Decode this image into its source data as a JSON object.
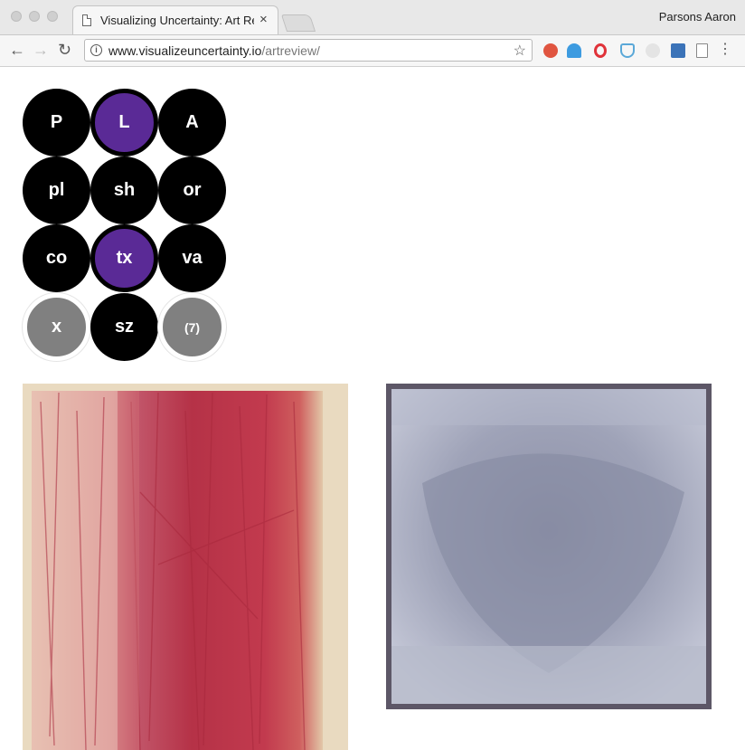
{
  "browser": {
    "tab_title": "Visualizing Uncertainty: Art Re",
    "tab_close": "×",
    "profile_name": "Parsons Aaron",
    "back_glyph": "←",
    "forward_glyph": "→",
    "reload_glyph": "↻",
    "url_host": "www.visualizeuncertainty.io",
    "url_path": "/artreview/",
    "info_glyph": "i",
    "star_glyph": "☆",
    "menu_glyph": "⋮",
    "extensions": [
      "adblock-icon",
      "news-globe-icon",
      "opera-icon",
      "shield-icon",
      "pin-icon",
      "new-badge-icon",
      "page-icon"
    ]
  },
  "grid": {
    "selected_color": "#5a2a96",
    "default_color": "#000000",
    "disabled_color": "#808080",
    "buttons": [
      {
        "label": "P",
        "state": "default"
      },
      {
        "label": "L",
        "state": "selected"
      },
      {
        "label": "A",
        "state": "default"
      },
      {
        "label": "pl",
        "state": "default"
      },
      {
        "label": "sh",
        "state": "default"
      },
      {
        "label": "or",
        "state": "default"
      },
      {
        "label": "co",
        "state": "default"
      },
      {
        "label": "tx",
        "state": "selected"
      },
      {
        "label": "va",
        "state": "default"
      },
      {
        "label": "x",
        "state": "disabled"
      },
      {
        "label": "sz",
        "state": "default"
      },
      {
        "label": "(7)",
        "state": "disabled"
      }
    ]
  },
  "artworks": [
    {
      "name": "red-abstract-painting",
      "palette": [
        "#e9dac0",
        "#c23a4e",
        "#a8283c"
      ]
    },
    {
      "name": "gray-blue-abstract-painting",
      "palette": [
        "#8c8fa6",
        "#b6bacb",
        "#5d5767"
      ]
    }
  ]
}
